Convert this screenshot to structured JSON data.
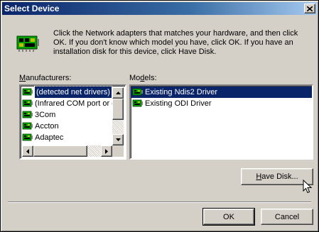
{
  "window": {
    "title": "Select Device"
  },
  "instructions": "Click the Network adapters that matches your hardware, and then click OK. If you don't know which model you have, click OK. If you have an installation disk for this device, click Have Disk.",
  "manufacturers": {
    "label_prefix": "",
    "label_accel": "M",
    "label_rest": "anufacturers:",
    "items": [
      {
        "label": "(detected net drivers)",
        "selected": true
      },
      {
        "label": "(Infrared COM port or dc"
      },
      {
        "label": "3Com"
      },
      {
        "label": "Accton"
      },
      {
        "label": "Adaptec"
      }
    ]
  },
  "models": {
    "label_prefix": "Mo",
    "label_accel": "d",
    "label_rest": "els:",
    "items": [
      {
        "label": "Existing Ndis2 Driver",
        "selected": true
      },
      {
        "label": "Existing ODI Driver"
      }
    ]
  },
  "buttons": {
    "have_disk_accel": "H",
    "have_disk_rest": "ave Disk...",
    "ok": "OK",
    "cancel": "Cancel"
  },
  "colors": {
    "face": "#d4d0c8",
    "selection": "#0a246a",
    "titlebar_start": "#0a246a",
    "titlebar_end": "#a6caf0"
  }
}
